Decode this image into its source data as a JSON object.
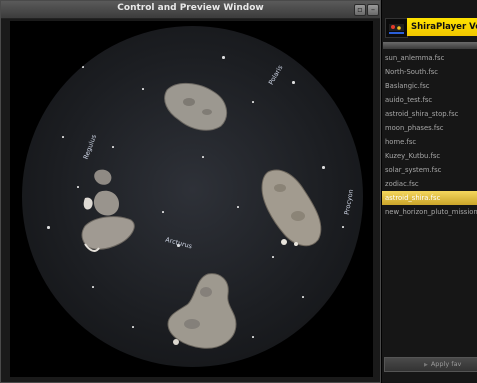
{
  "preview": {
    "title": "Control and Preview Window",
    "star_labels": [
      "Polaris",
      "Procyon",
      "Arcturus",
      "Regulus"
    ]
  },
  "sidebar": {
    "app_name": "ShiraPlayer Vers",
    "files": [
      {
        "label": "sun_anlemma.fsc",
        "selected": false
      },
      {
        "label": "North-South.fsc",
        "selected": false
      },
      {
        "label": "Baslangic.fsc",
        "selected": false
      },
      {
        "label": "auido_test.fsc",
        "selected": false
      },
      {
        "label": "astroid_shira_stop.fsc",
        "selected": false
      },
      {
        "label": "moon_phases.fsc",
        "selected": false
      },
      {
        "label": "home.fsc",
        "selected": false
      },
      {
        "label": "Kuzey_Kutbu.fsc",
        "selected": false
      },
      {
        "label": "solar_system.fsc",
        "selected": false
      },
      {
        "label": "zodiac.fsc",
        "selected": false
      },
      {
        "label": "astroid_shira.fsc",
        "selected": true
      },
      {
        "label": "new_horizon_pluto_mission.fsc",
        "selected": false
      }
    ],
    "apply_label": "Apply fav"
  },
  "colors": {
    "selected_bg": "#e8c640",
    "app_name_bg": "#ffe300"
  }
}
